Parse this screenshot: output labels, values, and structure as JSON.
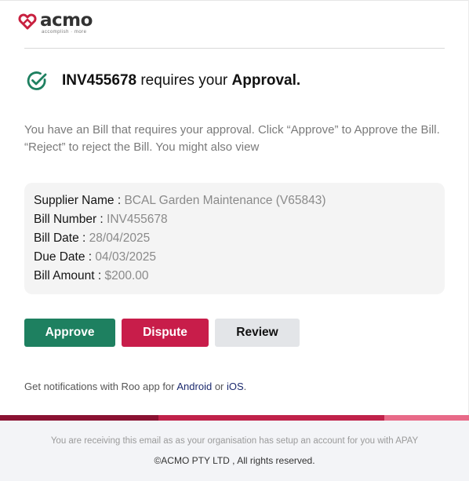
{
  "brand": {
    "name": "acmo",
    "tagline": "accomplish · more",
    "color": "#c8203f"
  },
  "heading": {
    "invoice_id": "INV455678",
    "middle": " requires your ",
    "emphasis": "Approval."
  },
  "intro": {
    "text": "You have an Bill that requires your approval. Click “Approve” to Approve the Bill. “Reject” to reject the Bill. You might also  view"
  },
  "details": [
    {
      "label": "Supplier Name : ",
      "value": "BCAL Garden Maintenance (V65843)"
    },
    {
      "label": "Bill Number : ",
      "value": "INV455678"
    },
    {
      "label": "Bill Date : ",
      "value": "28/04/2025"
    },
    {
      "label": "Due Date : ",
      "value": "04/03/2025"
    },
    {
      "label": "Bill Amount : ",
      "value": "$200.00"
    }
  ],
  "actions": {
    "approve": "Approve",
    "dispute": "Dispute",
    "review": "Review"
  },
  "notifications": {
    "prefix": "Get notifications with Roo app for ",
    "android": "Android",
    "or": " or ",
    "ios": "iOS",
    "suffix": "."
  },
  "footer": {
    "note": "You are receiving this email as as your organisation has setup an account for you with APAY",
    "copyright": "©ACMO PTY LTD , All rights reserved."
  },
  "colors": {
    "approve": "#1e8060",
    "dispute": "#c81d4a",
    "review": "#e3e5e8",
    "check": "#1e8060"
  },
  "icons": {
    "logo": "acmo-heart-logo-icon",
    "status": "check-circle-icon"
  }
}
